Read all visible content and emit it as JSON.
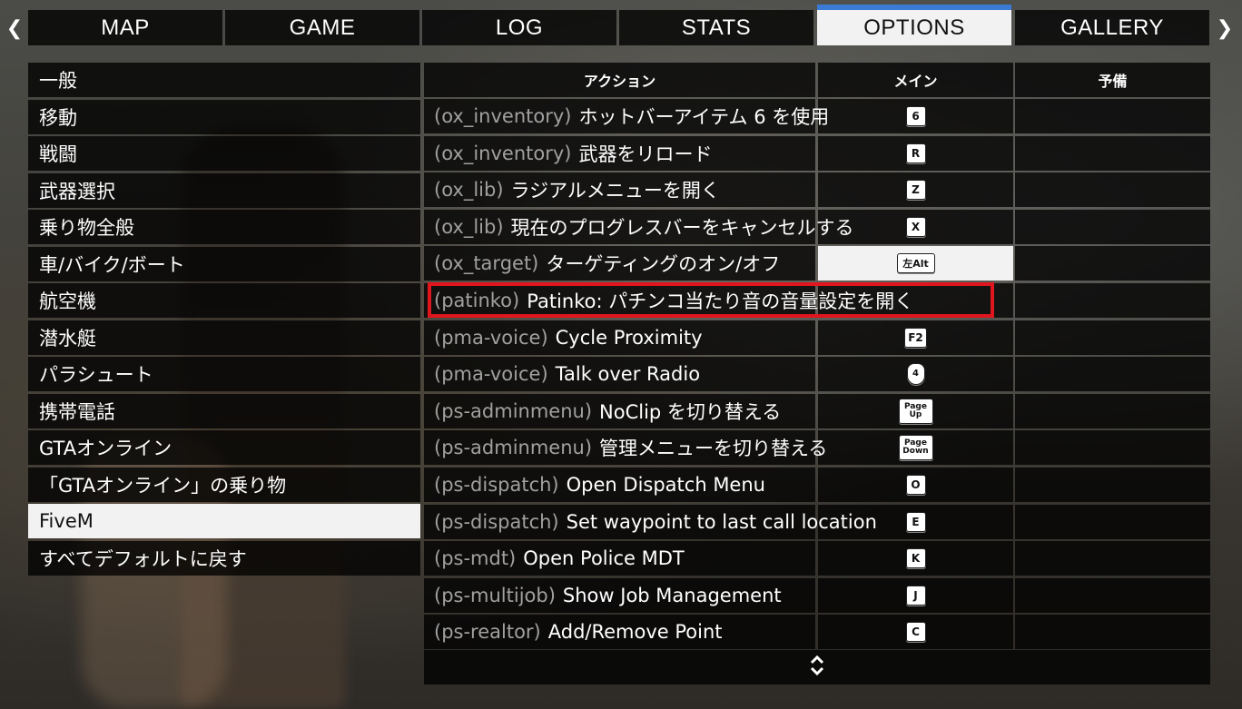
{
  "nav": {
    "prev_icon": "chevron-left-icon",
    "next_icon": "chevron-right-icon",
    "tabs": [
      {
        "label": "MAP",
        "active": false
      },
      {
        "label": "GAME",
        "active": false
      },
      {
        "label": "LOG",
        "active": false
      },
      {
        "label": "STATS",
        "active": false
      },
      {
        "label": "OPTIONS",
        "active": true
      },
      {
        "label": "GALLERY",
        "active": false
      }
    ],
    "accent_color": "#3b7bd6"
  },
  "categories": [
    {
      "label": "一般",
      "active": false
    },
    {
      "label": "移動",
      "active": false
    },
    {
      "label": "戦闘",
      "active": false
    },
    {
      "label": "武器選択",
      "active": false
    },
    {
      "label": "乗り物全般",
      "active": false
    },
    {
      "label": "車/バイク/ボート",
      "active": false
    },
    {
      "label": "航空機",
      "active": false
    },
    {
      "label": "潜水艇",
      "active": false
    },
    {
      "label": "パラシュート",
      "active": false
    },
    {
      "label": "携帯電話",
      "active": false
    },
    {
      "label": "GTAオンライン",
      "active": false
    },
    {
      "label": "「GTAオンライン」の乗り物",
      "active": false
    },
    {
      "label": "FiveM",
      "active": true
    },
    {
      "label": "すべてデフォルトに戻す",
      "active": false
    }
  ],
  "table": {
    "headers": {
      "action": "アクション",
      "main": "メイン",
      "alt": "予備"
    },
    "rows": [
      {
        "resource": "(ox_inventory)",
        "name": "ホットバーアイテム 6 を使用",
        "main_key": "6",
        "key_style": "normal"
      },
      {
        "resource": "(ox_inventory)",
        "name": "武器をリロード",
        "main_key": "R",
        "key_style": "normal"
      },
      {
        "resource": "(ox_lib)",
        "name": "ラジアルメニューを開く",
        "main_key": "Z",
        "key_style": "normal"
      },
      {
        "resource": "(ox_lib)",
        "name": "現在のプログレスバーをキャンセルする",
        "main_key": "X",
        "key_style": "normal"
      },
      {
        "resource": "(ox_target)",
        "name": "ターゲティングのオン/オフ",
        "main_key": "左Alt",
        "key_style": "wide"
      },
      {
        "resource": "(patinko)",
        "name": "Patinko: パチンコ当たり音の音量設定を開く",
        "main_key": "",
        "key_style": "none"
      },
      {
        "resource": "(pma-voice)",
        "name": "Cycle Proximity",
        "main_key": "F2",
        "key_style": "normal"
      },
      {
        "resource": "(pma-voice)",
        "name": "Talk over Radio",
        "main_key": "4",
        "key_style": "mouse"
      },
      {
        "resource": "(ps-adminmenu)",
        "name": "NoClip を切り替える",
        "main_key": "Page Up",
        "key_style": "small"
      },
      {
        "resource": "(ps-adminmenu)",
        "name": "管理メニューを切り替える",
        "main_key": "Page Down",
        "key_style": "small"
      },
      {
        "resource": "(ps-dispatch)",
        "name": "Open Dispatch Menu",
        "main_key": "O",
        "key_style": "normal"
      },
      {
        "resource": "(ps-dispatch)",
        "name": "Set waypoint to last call location",
        "main_key": "E",
        "key_style": "normal"
      },
      {
        "resource": "(ps-mdt)",
        "name": "Open Police MDT",
        "main_key": "K",
        "key_style": "normal"
      },
      {
        "resource": "(ps-multijob)",
        "name": "Show Job Management",
        "main_key": "J",
        "key_style": "normal"
      },
      {
        "resource": "(ps-realtor)",
        "name": "Add/Remove Point",
        "main_key": "C",
        "key_style": "normal"
      }
    ],
    "selected_row": 4,
    "highlighted_row": 5
  },
  "scroll_icon": "up-down-chevrons-icon",
  "highlight_color": "#e0161e"
}
